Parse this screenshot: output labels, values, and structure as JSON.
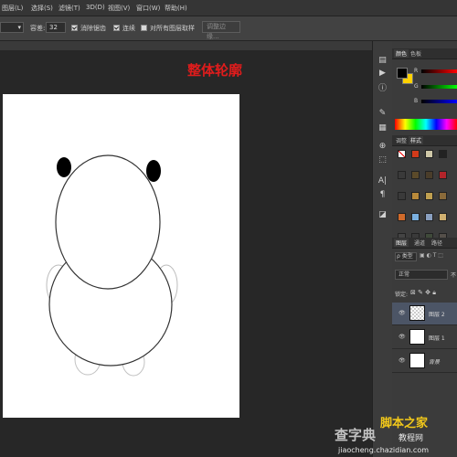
{
  "menubar": {
    "items": [
      "图层(L)",
      "选择(S)",
      "滤镜(T)",
      "3D(D)",
      "视图(V)",
      "窗口(W)",
      "帮助(H)"
    ]
  },
  "options": {
    "tolerance_label": "容差:",
    "tolerance_value": "32",
    "antialias_label": "消除锯齿",
    "contiguous_label": "连续",
    "sample_all_label": "对所有图层取样",
    "refine_edge_label": "调整边缘..."
  },
  "canvas": {
    "heading": "整体轮廓"
  },
  "panels": {
    "color_tabs": [
      "颜色",
      "色板"
    ],
    "rgb_labels": [
      "R",
      "G",
      "B"
    ],
    "adjust_tabs": [
      "调整",
      "样式"
    ],
    "layer_tabs": [
      "图层",
      "通道",
      "路径"
    ],
    "kind_label": "ρ 类型",
    "blend_mode": "正常",
    "opacity_short": "不",
    "lock_label": "锁定:",
    "layers": [
      {
        "name": "图层 2",
        "selected": true
      },
      {
        "name": "图层 1",
        "selected": false
      },
      {
        "name": "背景",
        "selected": false
      }
    ]
  },
  "watermark": {
    "site_left": "查字典",
    "site_brand": "脚本之家",
    "tutorial_word": "教程网",
    "url": "jiaocheng.chazidian.com"
  },
  "colors": {
    "heading": "#e01c1c",
    "foreground": "#000000",
    "background_swatch": "#ffd200"
  }
}
